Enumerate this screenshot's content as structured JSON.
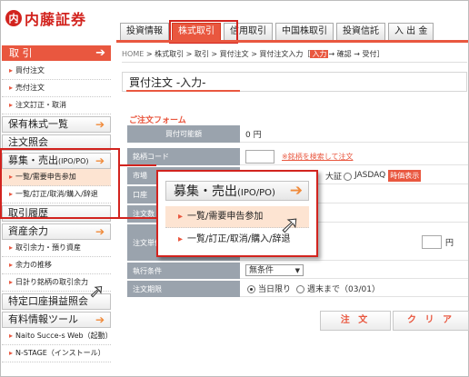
{
  "logo": {
    "mark": "内",
    "text": "内藤証券"
  },
  "tabs": [
    "投資情報",
    "株式取引",
    "信用取引",
    "中国株取引",
    "投資信託",
    "入 出 金"
  ],
  "sidebar": {
    "trade_head": "取 引",
    "trade_items": [
      "買付注文",
      "売付注文",
      "注文訂正・取消"
    ],
    "groups": [
      {
        "label": "保有株式一覧"
      },
      {
        "label": "注文照会"
      },
      {
        "label": "募集・売出",
        "small": "(IPO/PO)"
      }
    ],
    "ipo_items": [
      "一覧/需要申告参加",
      "一覧/訂正/取消/購入/辞退"
    ],
    "history_head": "取引履歴",
    "funds_head": "資産余力",
    "funds_items": [
      "取引余力・預り資産",
      "余力の推移",
      "日計り銘柄の取引余力"
    ],
    "tokutei_head": "特定口座損益照会",
    "tools_head": "有料情報ツール",
    "tools_items": [
      "Naito Succe-s Web（起動）",
      "N-STAGE（インストール）"
    ]
  },
  "breadcrumb": {
    "home": "HOME",
    "path": " > 株式取引 > 取引 > 買付注文 > 買付注文入力［",
    "current": "入力",
    "rest": "→ 確認 → 受付］"
  },
  "page_title": "買付注文 -入力-",
  "form": {
    "section_title": "ご注文フォーム",
    "available_label": "買付可能額",
    "available_value": "0 円",
    "code_label": "銘柄コード",
    "code_link": "※銘柄を検索して注文",
    "market_label": "市場",
    "market_visible": "大証",
    "market_jasdaq": "JASDAQ",
    "market_badge": "時価表示",
    "account_label": "口座",
    "qty_label": "注文数",
    "price_label": "注文単価",
    "price_unit": "円",
    "cond_label": "執行条件",
    "cond_value": "無条件",
    "period_label": "注文期限",
    "period_today": "当日限り",
    "period_week": "週末まで（03/01）",
    "submit_label": "注 文",
    "clear_label": "ク リ ア"
  },
  "callout": {
    "head": "募集・売出",
    "small": "(IPO/PO)",
    "items": [
      "一覧/需要申告参加",
      "一覧/訂正/取消/購入/辞退"
    ]
  },
  "colors": {
    "brand_red": "#d2231e",
    "accent_orange": "#e9573f",
    "label_gray": "#9aa3ad",
    "highlight": "#fde4d2"
  },
  "icons": {
    "arrow": "right-arrow-icon",
    "pointer": "mouse-pointer-icon",
    "radio": "radio-icon",
    "dropdown": "chevron-down-icon"
  }
}
